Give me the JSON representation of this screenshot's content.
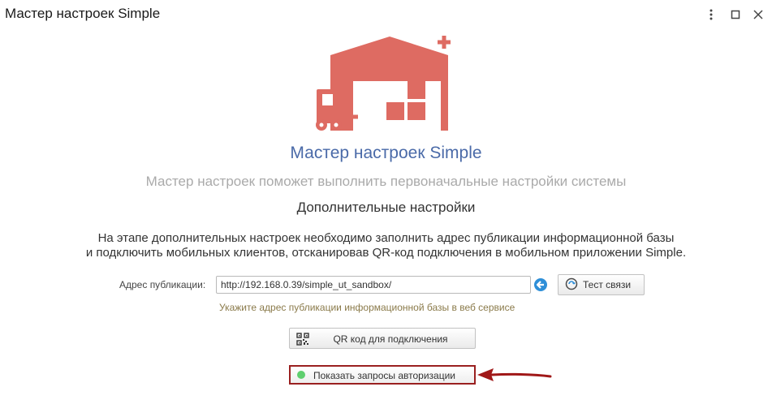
{
  "window": {
    "title": "Мастер настроек Simple"
  },
  "wizard": {
    "title": "Мастер настроек Simple",
    "subtitle": "Мастер настроек поможет выполнить первоначальные настройки системы",
    "step_title": "Дополнительные настройки",
    "description_line1": "На этапе дополнительных настроек необходимо заполнить адрес публикации информационной базы",
    "description_line2": "и подключить мобильных клиентов, отсканировав QR-код подключения в мобильном приложении Simple."
  },
  "publication": {
    "label": "Адрес публикации:",
    "value": "http://192.168.0.39/simple_ut_sandbox/",
    "hint": "Укажите адрес публикации информационной базы в веб сервисе",
    "test_button": "Тест связи"
  },
  "qr_button": {
    "label": "QR код для подключения"
  },
  "auth_button": {
    "label": "Показать запросы авторизации",
    "status_color": "#5fcf6f"
  },
  "colors": {
    "logo": "#de6b62",
    "title": "#4a6aa8",
    "highlight_border": "#9a2020"
  },
  "icons": [
    "more-icon",
    "maximize-icon",
    "close-icon",
    "warehouse-logo",
    "go-arrow-icon",
    "connection-test-icon",
    "qr-code-icon",
    "status-dot-icon",
    "pointer-arrow"
  ]
}
